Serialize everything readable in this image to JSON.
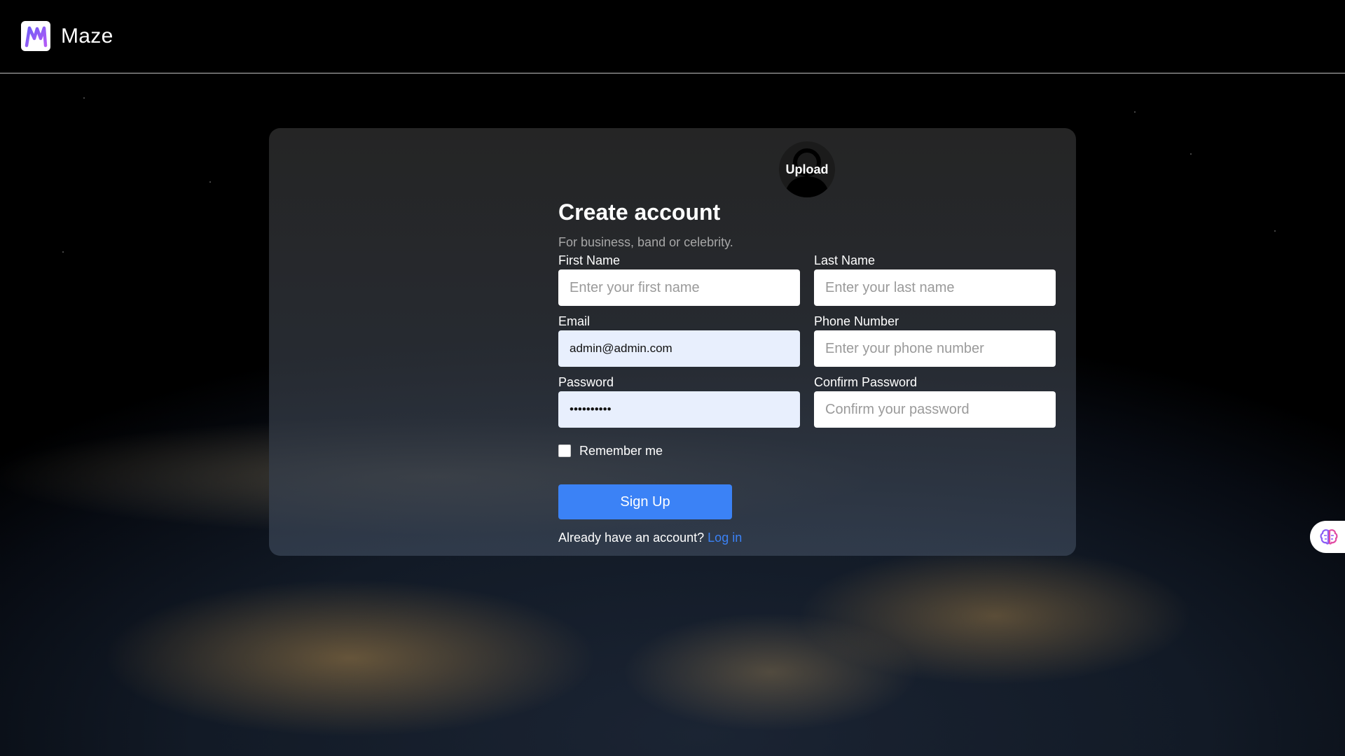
{
  "header": {
    "brand": "Maze",
    "logo_icon": "maze-logo-icon"
  },
  "card": {
    "avatar_label": "Upload",
    "title": "Create account",
    "subtitle": "For business, band or celebrity.",
    "fields": {
      "first_name": {
        "label": "First Name",
        "placeholder": "Enter your first name",
        "value": ""
      },
      "last_name": {
        "label": "Last Name",
        "placeholder": "Enter your last name",
        "value": ""
      },
      "email": {
        "label": "Email",
        "placeholder": "",
        "value": "admin@admin.com"
      },
      "phone": {
        "label": "Phone Number",
        "placeholder": "Enter your phone number",
        "value": ""
      },
      "password": {
        "label": "Password",
        "placeholder": "",
        "value": "••••••••••"
      },
      "confirm_password": {
        "label": "Confirm Password",
        "placeholder": "Confirm your password",
        "value": ""
      }
    },
    "remember_label": "Remember me",
    "submit_label": "Sign Up",
    "login_prompt": "Already have an account?",
    "login_link": "Log in"
  },
  "float_widget": {
    "icon": "brain-icon"
  },
  "colors": {
    "accent": "#3b82f6",
    "logo_purple": "#8b5cf6",
    "filled_input_bg": "#e8effd"
  }
}
